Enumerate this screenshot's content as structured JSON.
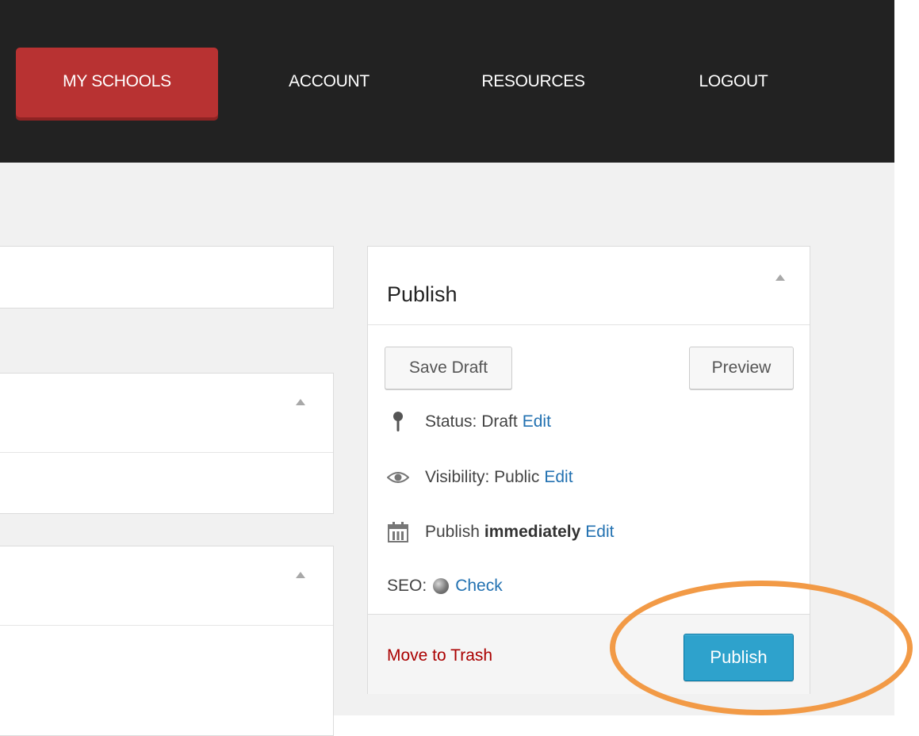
{
  "nav": {
    "items": [
      {
        "label": "MY SCHOOLS",
        "active": true
      },
      {
        "label": "ACCOUNT",
        "active": false
      },
      {
        "label": "RESOURCES",
        "active": false
      },
      {
        "label": "LOGOUT",
        "active": false
      }
    ],
    "active_color": "#b83232",
    "bar_color": "#222222"
  },
  "publish": {
    "title": "Publish",
    "save_draft_label": "Save Draft",
    "preview_label": "Preview",
    "status": {
      "label": "Status:",
      "value": "Draft",
      "edit": "Edit",
      "icon": "pin-icon"
    },
    "visibility": {
      "label": "Visibility:",
      "value": "Public",
      "edit": "Edit",
      "icon": "eye-icon"
    },
    "schedule": {
      "label": "Publish",
      "value": "immediately",
      "edit": "Edit",
      "icon": "calendar-icon"
    },
    "seo": {
      "label": "SEO:",
      "check": "Check",
      "icon": "seo-status-dot-icon"
    },
    "move_to_trash": "Move to Trash",
    "publish_button": "Publish"
  },
  "colors": {
    "link": "#2271b1",
    "trash": "#aa0000",
    "publish_button": "#2ea2cc",
    "highlight": "#f29a46"
  }
}
